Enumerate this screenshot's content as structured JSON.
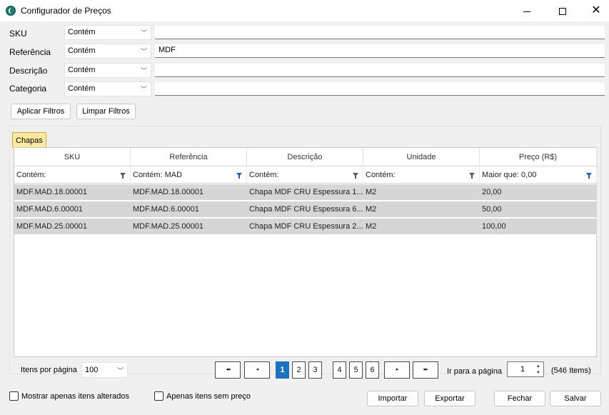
{
  "window": {
    "title": "Configurador de Preços"
  },
  "filters": [
    {
      "label": "SKU",
      "operator": "Contém",
      "value": ""
    },
    {
      "label": "Referência",
      "operator": "Contém",
      "value": "MDF"
    },
    {
      "label": "Descrição",
      "operator": "Contém",
      "value": ""
    },
    {
      "label": "Categoria",
      "operator": "Contém",
      "value": ""
    }
  ],
  "filter_buttons": {
    "apply": "Aplicar Filtros",
    "clear": "Limpar Filtros"
  },
  "tab": {
    "label": "Chapas"
  },
  "grid": {
    "columns": [
      "SKU",
      "Referência",
      "Descrição",
      "Unidade",
      "Preço (R$)"
    ],
    "column_filters": [
      "Contém:",
      "Contém:  MAD",
      "Contém:",
      "Contém:",
      "Maior que:  0,00"
    ],
    "rows": [
      [
        "MDF.MAD.18.00001",
        "MDF.MAD.18.00001",
        "Chapa MDF CRU Espessura 1...",
        "M2",
        "20,00"
      ],
      [
        "MDF.MAD.6.00001",
        "MDF.MAD.6.00001",
        "Chapa MDF CRU Espessura 6...",
        "M2",
        "50,00"
      ],
      [
        "MDF.MAD.25.00001",
        "MDF.MAD.25.00001",
        "Chapa MDF CRU Espessura 2...",
        "M2",
        "100,00"
      ]
    ]
  },
  "pager": {
    "items_per_page_label": "Itens por página",
    "items_per_page": "100",
    "first": "◂◂",
    "prev": "◂",
    "pages": [
      "1",
      "2",
      "3",
      "4",
      "5",
      "6"
    ],
    "current_page": "1",
    "next": "▸",
    "last": "▸▸",
    "goto_label": "Ir para a página",
    "goto_value": "1",
    "items_count": "(546 Items)"
  },
  "footer": {
    "only_changed": "Mostrar apenas itens alterados",
    "no_price": "Apenas itens sem preço",
    "import": "Importar",
    "export": "Exportar",
    "close": "Fechar",
    "save": "Salvar"
  },
  "colors": {
    "tab_bg": "#fde99f",
    "row_bg": "#d6d6d6",
    "active_page": "#1e73be"
  }
}
